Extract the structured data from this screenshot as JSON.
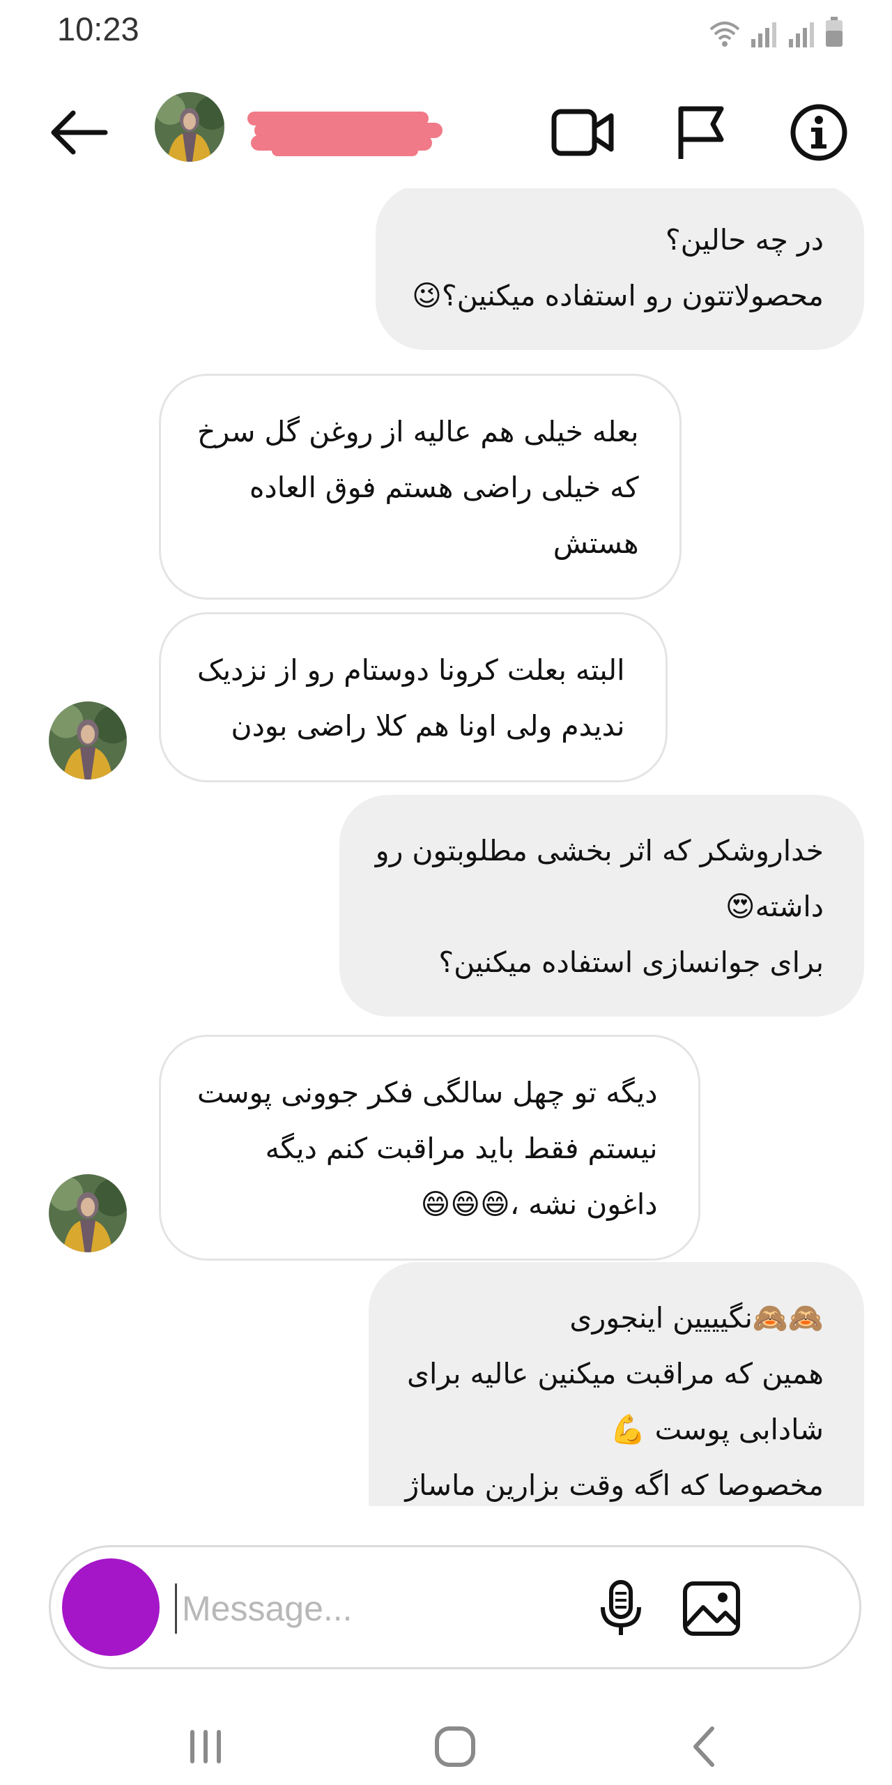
{
  "status_bar": {
    "time": "10:23",
    "icons": [
      "wifi-icon",
      "signal-icon",
      "signal-icon",
      "battery-icon"
    ]
  },
  "header": {
    "back_icon": "arrow-left-icon",
    "contact_name": "",
    "actions": [
      "video-call-icon",
      "flag-icon",
      "info-icon"
    ]
  },
  "messages": [
    {
      "side": "sent",
      "lines": [
        "در چه حالین؟",
        "محصولاتتون رو استفاده میکنین؟😉"
      ]
    },
    {
      "side": "received",
      "lines": [
        "بعله خیلی هم عالیه از روغن گل سرخ",
        "که خیلی راضی هستم فوق العاده",
        "هستش"
      ]
    },
    {
      "side": "received",
      "lines": [
        "البته بعلت کرونا دوستام رو از نزدیک",
        "ندیدم ولی اونا هم کلا راضی بودن"
      ]
    },
    {
      "side": "sent",
      "lines": [
        "خداروشکر که اثر بخشی مطلوبتون رو",
        "داشته😍",
        "برای جوانسازی استفاده میکنین؟"
      ]
    },
    {
      "side": "received",
      "lines": [
        "دیگه تو چهل سالگی فکر جوونی پوست",
        "نیستم فقط باید مراقبت کنم دیگه",
        "داغون نشه ،😄😄😄"
      ]
    },
    {
      "side": "sent",
      "lines": [
        "🙈🙈نگیییین اینجوری",
        "همین که مراقبت میکنین عالیه برای",
        "شادابی پوست 💪",
        "مخصوصا که اگه وقت بزارین ماساژ"
      ]
    }
  ],
  "composer": {
    "placeholder": "Message...",
    "camera_color": "#a516c8",
    "icons": [
      "microphone-icon",
      "gallery-icon"
    ]
  },
  "navbar": {
    "buttons": [
      "recent-apps-icon",
      "home-icon",
      "back-nav-icon"
    ]
  },
  "colors": {
    "sent_bubble": "#efefef",
    "received_border": "#e4e4e4",
    "redaction": "#f07a87",
    "icon": "#111111"
  }
}
